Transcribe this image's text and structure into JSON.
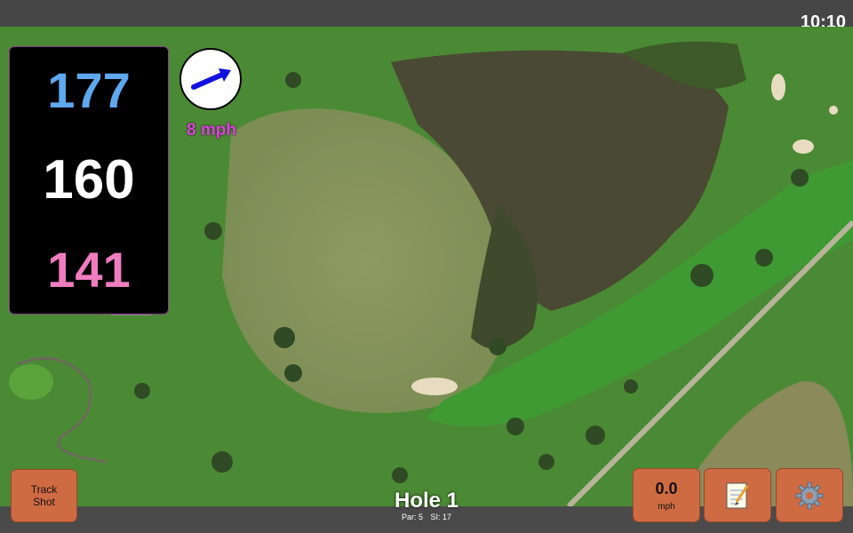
{
  "status_bar": {
    "time": "10:10"
  },
  "distances": {
    "back": "177",
    "middle": "160",
    "front": "141"
  },
  "wind": {
    "speed": "8 mph",
    "direction_icon": "arrow-icon"
  },
  "buttons": {
    "track_shot_line1": "Track",
    "track_shot_line2": "Shot",
    "speed_value": "0.0",
    "speed_unit": "mph",
    "notes_icon": "notepad-icon",
    "settings_icon": "gear-icon"
  },
  "hole": {
    "title": "Hole 1",
    "par": "Par: 5",
    "stroke_index": "SI: 17"
  },
  "colors": {
    "back_distance": "#5ea8ee",
    "middle_distance": "#ffffff",
    "front_distance": "#f07cc0",
    "wind_text": "#e040e0",
    "button": "#cf6b43"
  }
}
